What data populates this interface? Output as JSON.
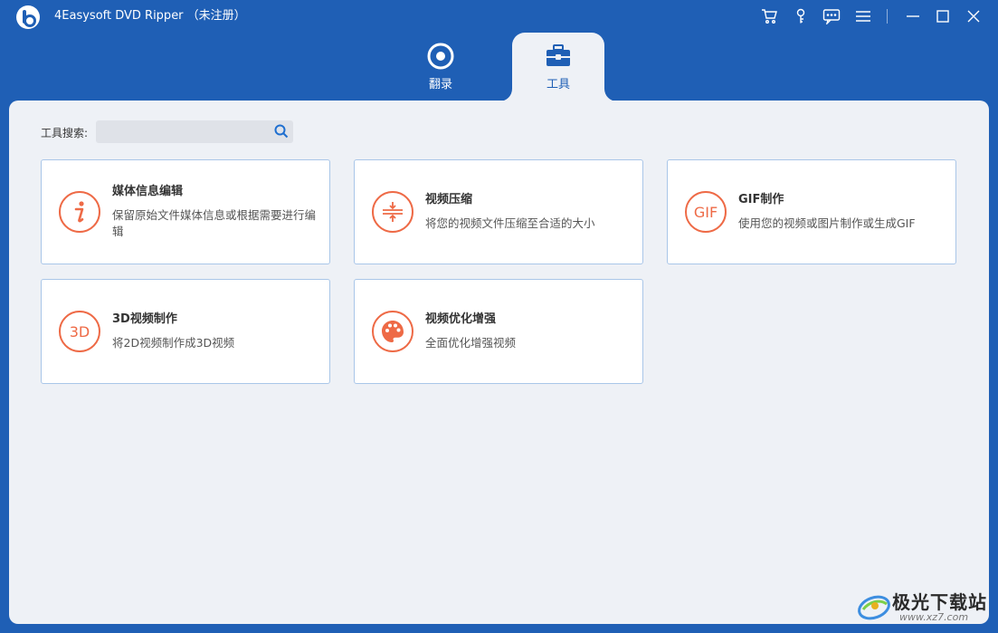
{
  "app": {
    "title": "4Easysoft DVD Ripper  （未注册）"
  },
  "titlebar": {
    "buttons": [
      "cart-icon",
      "key-icon",
      "feedback-icon",
      "menu-icon",
      "minimize-icon",
      "maximize-icon",
      "close-icon"
    ]
  },
  "tabs": [
    {
      "label": "翻录",
      "icon": "disc-icon",
      "active": false
    },
    {
      "label": "工具",
      "icon": "toolbox-icon",
      "active": true
    }
  ],
  "search": {
    "label": "工具搜索:",
    "value": "",
    "placeholder": ""
  },
  "tools": [
    {
      "title": "媒体信息编辑",
      "desc": "保留原始文件媒体信息或根据需要进行编辑",
      "icon": "info-icon"
    },
    {
      "title": "视频压缩",
      "desc": "将您的视频文件压缩至合适的大小",
      "icon": "compress-icon"
    },
    {
      "title": "GIF制作",
      "desc": "使用您的视频或图片制作或生成GIF",
      "icon": "gif-icon",
      "icon_text": "GIF"
    },
    {
      "title": "3D视频制作",
      "desc": "将2D视频制作成3D视频",
      "icon": "3d-icon",
      "icon_text": "3D"
    },
    {
      "title": "视频优化增强",
      "desc": "全面优化增强视频",
      "icon": "palette-icon"
    }
  ],
  "watermark": {
    "text": "极光下载站",
    "url": "www.xz7.com"
  },
  "colors": {
    "brand": "#1f5fb5",
    "accent": "#ee6a46",
    "panel": "#eef1f6",
    "card_border": "#a9c6e8"
  }
}
